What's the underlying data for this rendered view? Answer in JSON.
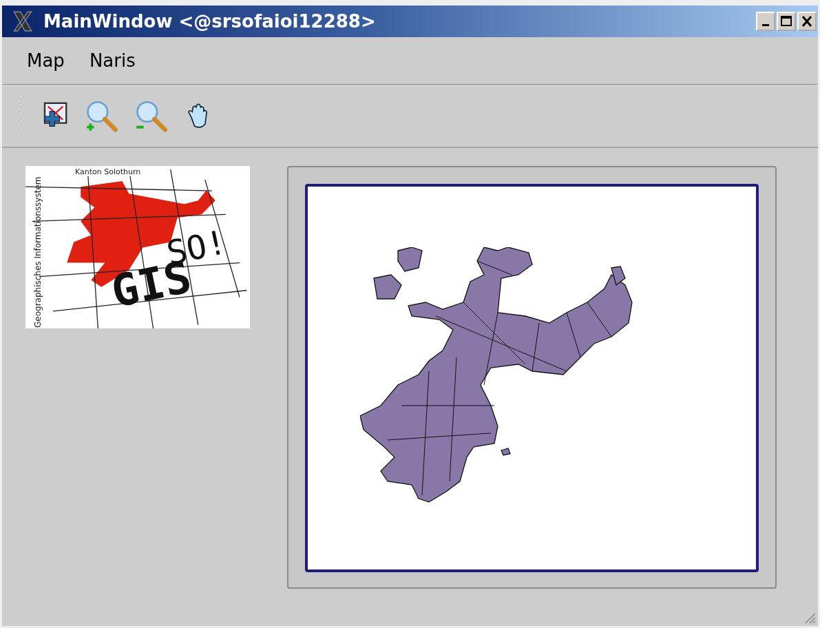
{
  "window": {
    "title": "MainWindow <@srsofaioi12288>"
  },
  "menu": [
    "Map",
    "Naris"
  ],
  "logo": {
    "region": "Kanton Solothurn",
    "subtitle": "Geographisches Informationssystem",
    "mark_top": "SO!",
    "mark_bottom": "GIS"
  }
}
